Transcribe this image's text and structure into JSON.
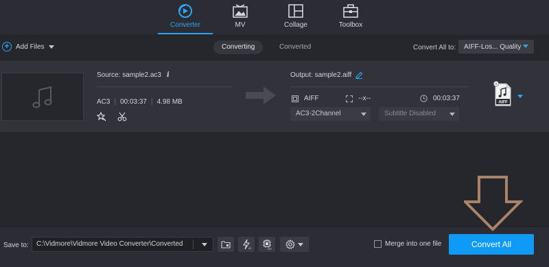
{
  "nav": {
    "tabs": [
      {
        "label": "Converter",
        "icon": "converter-icon",
        "active": true
      },
      {
        "label": "MV",
        "icon": "mv-icon",
        "active": false
      },
      {
        "label": "Collage",
        "icon": "collage-icon",
        "active": false
      },
      {
        "label": "Toolbox",
        "icon": "toolbox-icon",
        "active": false
      }
    ]
  },
  "subbar": {
    "add_files": "Add Files",
    "tab_converting": "Converting",
    "tab_converted": "Converted",
    "convert_all_label": "Convert All to:",
    "convert_all_value": "AIFF-Los... Quality"
  },
  "file": {
    "source": "Source: sample2.ac3",
    "info_glyph": "i",
    "format": "AC3",
    "duration": "00:03:37",
    "size": "4.98 MB",
    "sep": "|",
    "output": "Output: sample2.aiff",
    "out_format": "AIFF",
    "out_resolution": "--x--",
    "out_duration": "00:03:37",
    "audio_track": "AC3-2Channel",
    "subtitle": "Subtitle Disabled",
    "format_badge": "AIFF"
  },
  "bottom": {
    "save_to": "Save to:",
    "path": "C:\\Vidmore\\Vidmore Video Converter\\Converted",
    "merge": "Merge into one file",
    "convert": "Convert All"
  },
  "colors": {
    "accent": "#2aa7f0",
    "convert_button": "#0f9bf5",
    "overlay_arrow": "#a98466"
  }
}
